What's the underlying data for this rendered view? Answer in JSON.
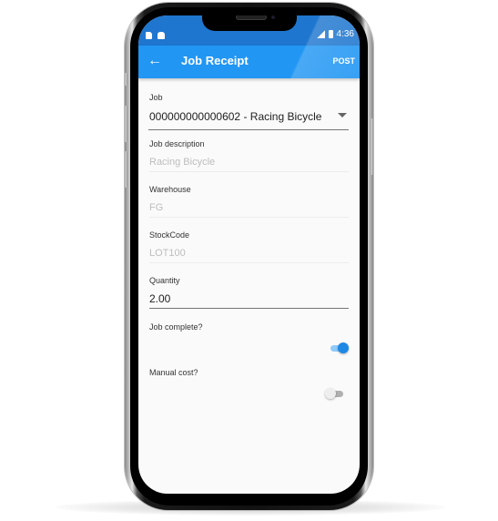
{
  "statusbar": {
    "left_icons": [
      "sim-card-icon",
      "android-icon"
    ],
    "right_icons": [
      "signal-icon",
      "battery-icon"
    ],
    "time": "4:36"
  },
  "appbar": {
    "back_icon": "arrow-left-icon",
    "back_glyph": "←",
    "title": "Job Receipt",
    "action_label": "POST",
    "color": "#2196f3"
  },
  "form": {
    "job": {
      "label": "Job",
      "value": "000000000000602 - Racing Bicycle"
    },
    "job_description": {
      "label": "Job description",
      "value": "Racing Bicycle"
    },
    "warehouse": {
      "label": "Warehouse",
      "value": "FG"
    },
    "stock_code": {
      "label": "StockCode",
      "value": "LOT100"
    },
    "quantity": {
      "label": "Quantity",
      "value": "2.00"
    },
    "job_complete": {
      "label": "Job complete?",
      "checked": true
    },
    "manual_cost": {
      "label": "Manual cost?",
      "checked": false
    }
  }
}
